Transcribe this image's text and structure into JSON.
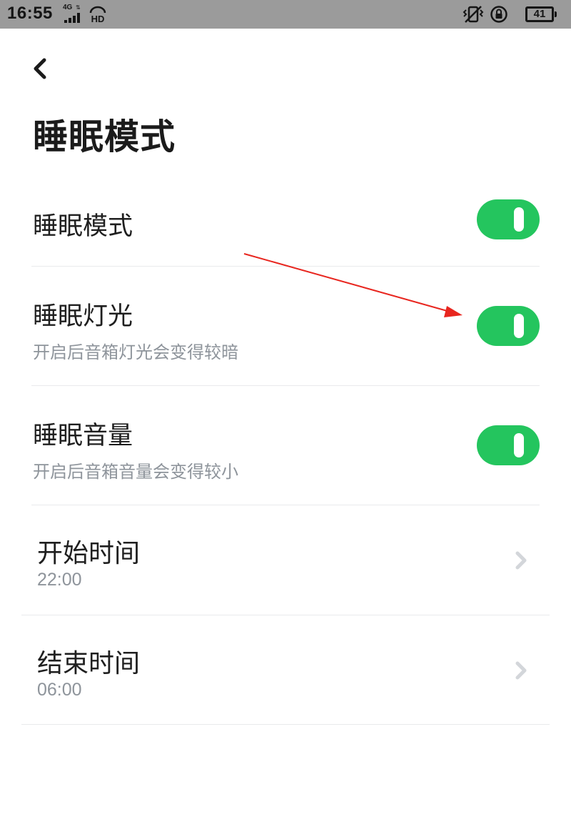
{
  "status_bar": {
    "time": "16:55",
    "network": "4G",
    "hd": "HD",
    "battery": "41"
  },
  "page": {
    "title": "睡眠模式"
  },
  "settings": [
    {
      "label": "睡眠模式",
      "description": "",
      "enabled": true
    },
    {
      "label": "睡眠灯光",
      "description": "开启后音箱灯光会变得较暗",
      "enabled": true
    },
    {
      "label": "睡眠音量",
      "description": "开启后音箱音量会变得较小",
      "enabled": true
    }
  ],
  "schedule": {
    "start": {
      "label": "开始时间",
      "value": "22:00"
    },
    "end": {
      "label": "结束时间",
      "value": "06:00"
    }
  },
  "colors": {
    "toggle_on": "#24c55e",
    "annotation_arrow": "#e8261f",
    "secondary_text": "#8e949b"
  },
  "icons": [
    "back-arrow-icon",
    "signal-icon",
    "hd-icon",
    "vibrate-icon",
    "rotation-lock-icon",
    "battery-icon",
    "chevron-right-icon"
  ]
}
